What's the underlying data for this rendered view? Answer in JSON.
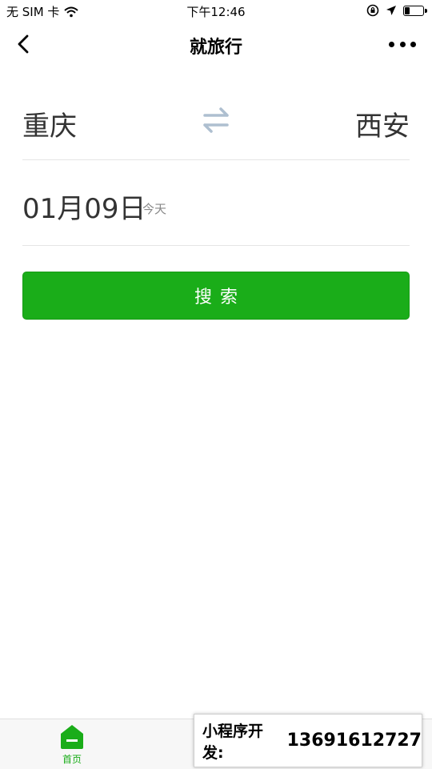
{
  "status_bar": {
    "carrier": "无 SIM 卡",
    "time": "下午12:46",
    "icons": [
      "wifi-icon",
      "orientation-lock-icon",
      "location-arrow-icon",
      "battery-icon"
    ]
  },
  "nav": {
    "title": "就旅行",
    "back_icon": "chevron-left-icon",
    "more_icon": "more-dots-icon"
  },
  "route": {
    "from_city": "重庆",
    "to_city": "西安",
    "swap_icon": "swap-arrows-icon"
  },
  "date": {
    "value": "01月09日",
    "hint": "今天"
  },
  "search": {
    "label": "搜索"
  },
  "tab_bar": {
    "items": [
      {
        "label": "首页",
        "icon": "home-icon",
        "active": true
      }
    ],
    "active_color": "#1aad19"
  },
  "promo": {
    "label": "小程序开发:",
    "phone": "13691612727"
  },
  "colors": {
    "accent": "#1aad19",
    "text": "#333333",
    "muted": "#888888",
    "divider": "#e5e5e5"
  }
}
